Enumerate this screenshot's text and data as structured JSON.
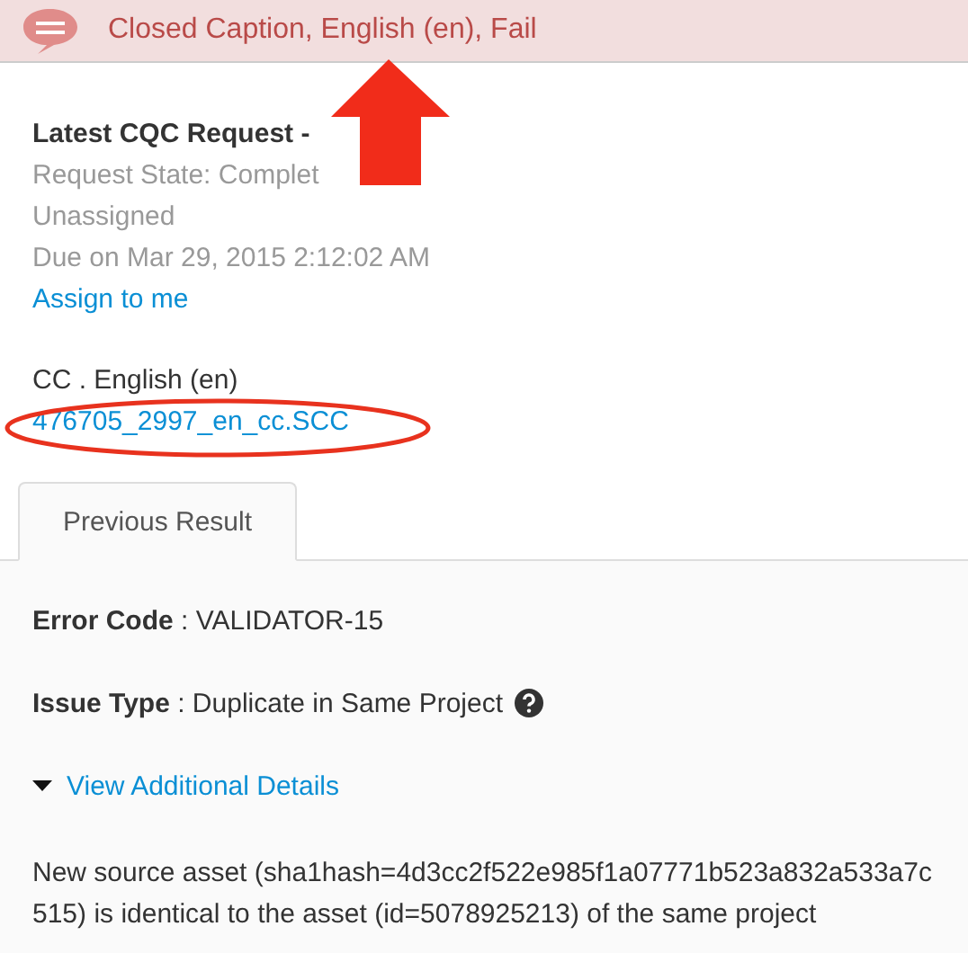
{
  "banner": {
    "title": "Closed Caption, English (en), Fail"
  },
  "request": {
    "title": "Latest CQC Request -",
    "state": "Request State: Complet",
    "assignee": "Unassigned",
    "due": "Due on Mar 29, 2015 2:12:02 AM",
    "assign_link": "Assign to me"
  },
  "file": {
    "label": "CC . English (en)",
    "link": "476705_2997_en_cc.SCC"
  },
  "tabs": [
    {
      "label": "Previous Result",
      "selected": true
    }
  ],
  "result": {
    "fields": [
      {
        "label": "Error Code",
        "value": " : VALIDATOR-15",
        "help": false
      },
      {
        "label": "Issue Type",
        "value": " : Duplicate in Same Project",
        "help": true
      }
    ],
    "details": {
      "label": "View Additional Details",
      "expanded": true
    },
    "message": "New source asset (sha1hash=4d3cc2f522e985f1a07771b523a832a533a7c515) is identical to the asset (id=5078925213) of the same project"
  }
}
